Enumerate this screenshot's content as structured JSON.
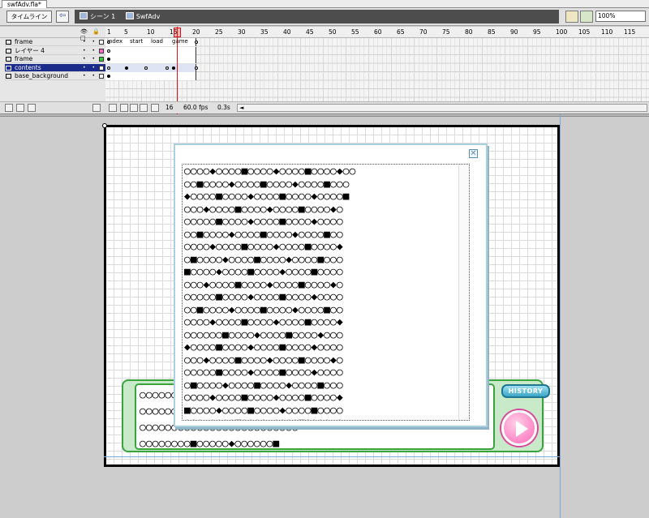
{
  "document": {
    "tab_title": "swfAdv.fla*"
  },
  "navbar": {
    "timeline_toggle": "タイムライン",
    "back_arrow": "⇦",
    "breadcrumb": [
      "シーン 1",
      "SwfAdv"
    ],
    "zoom": "100%",
    "icons": {
      "edit_scene": "clapper-icon",
      "edit_symbol": "symbol-icon",
      "back": "arrow-left-icon"
    }
  },
  "timeline": {
    "header_icons": "👁 🔒 □",
    "frame_numbers": [
      "1",
      "5",
      "10",
      "15",
      "20",
      "25",
      "30",
      "35",
      "40",
      "45",
      "50",
      "55",
      "60",
      "65",
      "70",
      "75",
      "80",
      "85",
      "90",
      "95",
      "100",
      "105",
      "110",
      "115"
    ],
    "layers": [
      {
        "name": "frame",
        "selected": false,
        "color": "#ffffff"
      },
      {
        "name": "レイヤー 4",
        "selected": false,
        "color": "#ff66cc"
      },
      {
        "name": "frame",
        "selected": false,
        "color": "#33cc33"
      },
      {
        "name": "contents",
        "selected": true,
        "color": "#ffffff"
      },
      {
        "name": "base_background",
        "selected": false,
        "color": "#ffffff"
      }
    ],
    "frame_labels": [
      "index",
      "start",
      "load",
      "game"
    ],
    "current_frame": "16",
    "frame_rate": "60.0 fps",
    "elapsed_time": "0.3s",
    "scroll_arrow": "◄"
  },
  "stage": {
    "message_text": "○○○○○○○○○○○○○○○○○○○○○○○○○\n○○○○○○○○○○○○○○○○○○○○○○○○○\n○○○○○○○○○○○○○○○○○○○○○○○○○\n○○○○○○○○■○○○○○◆○○○○○○■",
    "history_label": "HISTORY",
    "dialog_close": "✕",
    "dialog_text": "○○○○◆○○○○■○○○○◆○○○○■○○○○◆○○\n○○■○○○○◆○○○○■○○○○◆○○○○■○○○\n◆○○○○■○○○○◆○○○○■○○○○◆○○○○■\n○○○◆○○○○■○○○○◆○○○○■○○○○◆○\n○○○○○■○○○○◆○○○○■○○○○◆○○○○\n○○■○○○○◆○○○○■○○○○◆○○○○■○○\n○○○○◆○○○○■○○○○◆○○○○■○○○○◆\n○■○○○○◆○○○○■○○○○◆○○○○■○○○\n■○○○○◆○○○○■○○○○◆○○○○■○○○○\n○○○◆○○○○■○○○○◆○○○○■○○○○◆○\n○○○○○■○○○○◆○○○○■○○○○◆○○○○\n○○■○○○○◆○○○○■○○○○◆○○○○■○○\n○○○○◆○○○○■○○○○◆○○○○■○○○○◆\n○○○○○○■○○○○◆○○○○■○○○○◆○○○\n◆○○○○■○○○○◆○○○○■○○○○◆○○○○\n○○○◆○○○○■○○○○◆○○○○■○○○○◆○\n○○○○○■○○○○◆○○○○■○○○○◆○○○○\n○■○○○○◆○○○○■○○○○◆○○○○■○○○\n○○○○◆○○○○■○○○○◆○○○○■○○○○◆\n■○○○○◆○○○○■○○○○◆○○○○■○○○○\n○○○◆○○○○■○○○○◆○○○○■○○○○◆○\n○○○○○■○○○○◆○○○○■○○○○◆○○○○\n○○■○○○○◆○○○○■○○○○◆○○○○■○○\n○○○○◆○○○○■○○○○◆○○○○■○○○○◆\n○■○○○○◆○○○○■○○○○◆○○○○■○○○\n◆○○○○■○○○○◆○○○○■○○○○◆○○○○\n○○○◆○○○○■○○○○◆○○○○■○○○○◆○\n○○○○○■○○○○◆○○○○■○○○○◆○○○○\n○○■○○○○◆○○○○■○○○○◆○○○○■○○"
  }
}
